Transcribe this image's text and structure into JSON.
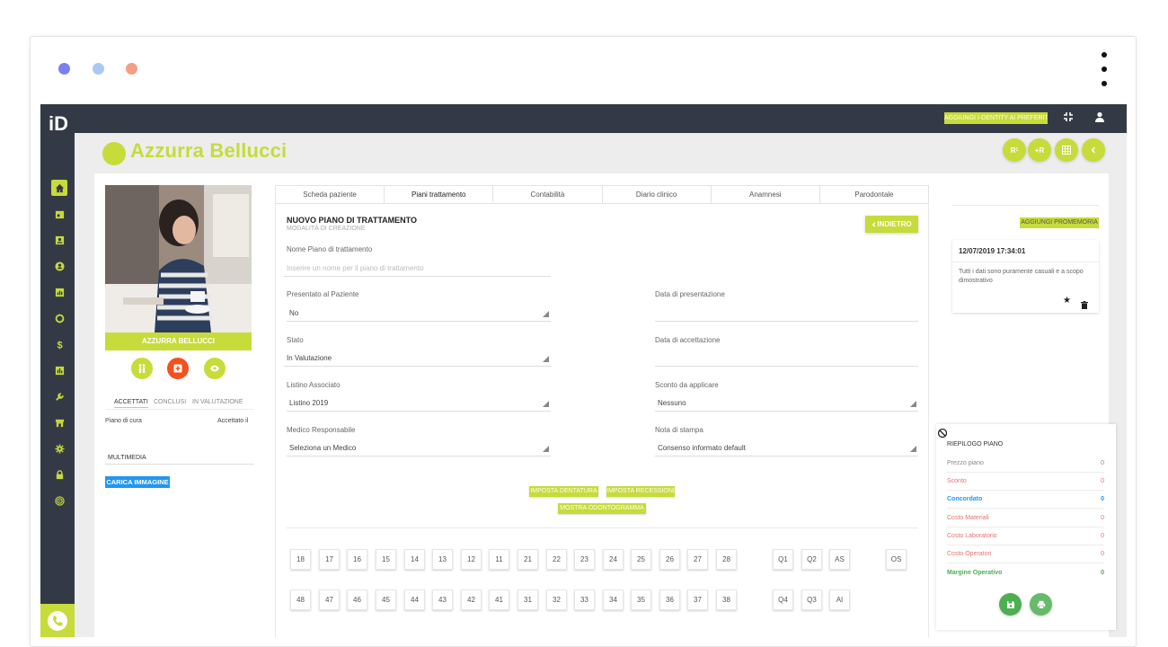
{
  "window": {
    "dots": [
      "#7b7ff0",
      "#a9c8f5",
      "#f59e86"
    ]
  },
  "topbar": {
    "logo": "iD",
    "favorite_label": "AGGIUNGI I-DENTITY AI PREFERITI"
  },
  "patient": {
    "name": "Azzurra Bellucci",
    "caption": "AZZURRA BELLUCCI"
  },
  "header_buttons": [
    "R",
    "+R",
    "",
    ""
  ],
  "left": {
    "subtabs": [
      "ACCETTATI",
      "CONCLUSI",
      "IN VALUTAZIONE"
    ],
    "col_left": "Piano di cura",
    "col_right": "Accettato il",
    "multimedia": "MULTIMEDIA",
    "upload": "CARICA IMMAGINE"
  },
  "tabs": [
    "Scheda paziente",
    "Piani trattamento",
    "Contabilità",
    "Diario clinico",
    "Anamnesi",
    "Parodontale"
  ],
  "form": {
    "title": "NUOVO PIANO DI TRATTAMENTO",
    "subtitle": "MODALITÀ DI CREAZIONE",
    "back": "INDIETRO",
    "name_label": "Nome Piano di trattamento",
    "name_placeholder": "Inserire un nome per il piano di trattamento",
    "presented_label": "Presentato al Paziente",
    "presented_value": "No",
    "presentation_date_label": "Data di presentazione",
    "state_label": "Stato",
    "state_value": "In Valutazione",
    "acceptance_date_label": "Data di accettazione",
    "list_label": "Listino Associato",
    "list_value": "Listino 2019",
    "discount_label": "Sconto da applicare",
    "discount_value": "Nessuno",
    "doctor_label": "Medico Responsabile",
    "doctor_value": "Seleziona un Medico",
    "print_label": "Nota di stampa",
    "print_value": "Consenso informato default",
    "btn_dentition": "IMPOSTA DENTATURA",
    "btn_recessions": "IMPOSTA RECESSIONI",
    "btn_odontogram": "MOSTRA ODONTOGRAMMA"
  },
  "teeth": {
    "upper": [
      "18",
      "17",
      "16",
      "15",
      "14",
      "13",
      "12",
      "11",
      "21",
      "22",
      "23",
      "24",
      "25",
      "26",
      "27",
      "28"
    ],
    "lower": [
      "48",
      "47",
      "46",
      "45",
      "44",
      "43",
      "42",
      "41",
      "31",
      "32",
      "33",
      "34",
      "35",
      "36",
      "37",
      "38"
    ],
    "upper_extra": [
      "Q1",
      "Q2",
      "AS"
    ],
    "lower_extra": [
      "Q4",
      "Q3",
      "AI"
    ],
    "os": "OS"
  },
  "reminder": {
    "button": "AGGIUNGI PROMEMORIA",
    "timestamp": "12/07/2019 17:34:01",
    "text": "Tutti i dati sono puramente casuali e a scopo dimostrativo"
  },
  "summary": {
    "title": "RIEPILOGO PIANO",
    "rows": [
      {
        "label": "Prezzo piano",
        "value": "0",
        "color": "#888888"
      },
      {
        "label": "Sconto",
        "value": "0",
        "color": "#e57373"
      },
      {
        "label": "Concordato",
        "value": "0",
        "color": "#2196f3"
      },
      {
        "label": "Costo Materiali",
        "value": "0",
        "color": "#e57373"
      },
      {
        "label": "Costo Laboratorio",
        "value": "0",
        "color": "#e57373"
      },
      {
        "label": "Costo Operatori",
        "value": "0",
        "color": "#e57373"
      },
      {
        "label": "Margine Operativo",
        "value": "0",
        "color": "#4caf50"
      }
    ]
  },
  "colors": {
    "accent": "#c7db3a",
    "dark": "#343a45",
    "orange": "#f4511e",
    "blue": "#2196f3",
    "green": "#4caf50"
  }
}
